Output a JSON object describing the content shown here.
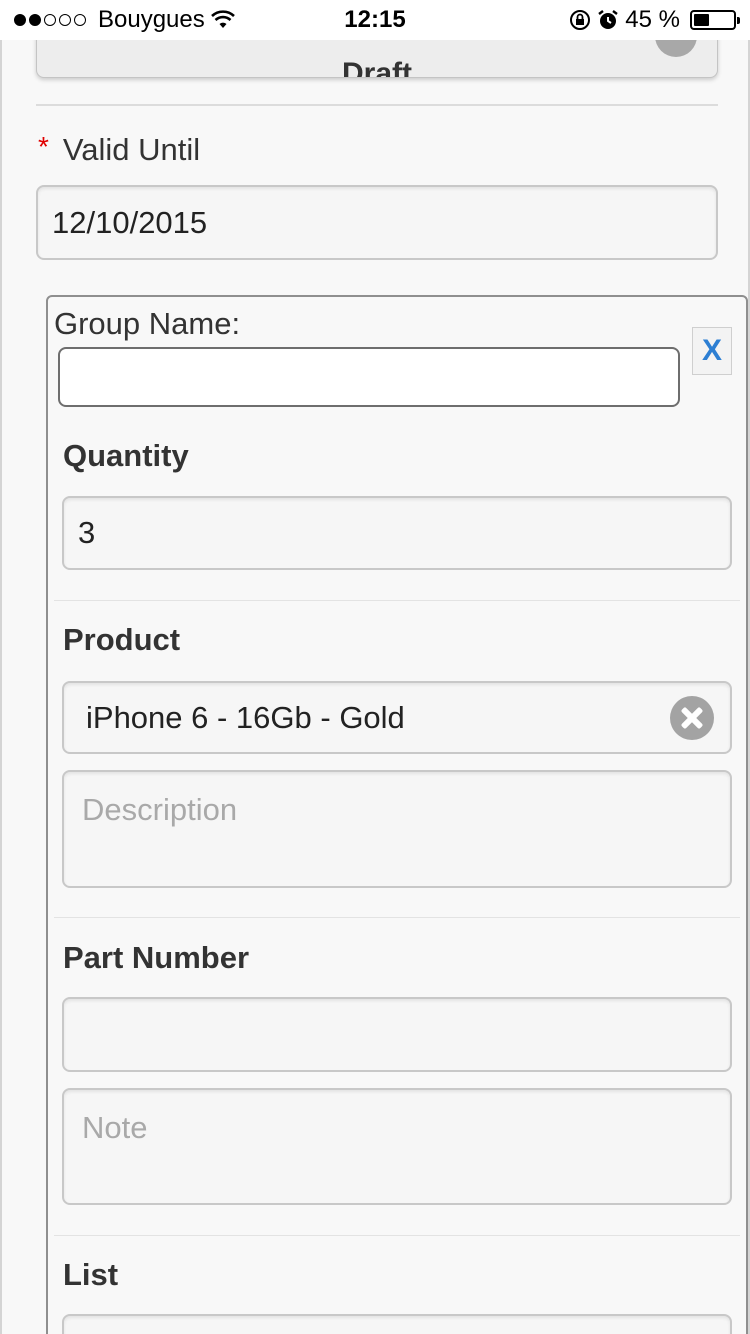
{
  "status_bar": {
    "carrier": "Bouygues",
    "time": "12:15",
    "battery_percent": "45 %",
    "battery_level": 0.45,
    "signal_bars_filled": 2,
    "signal_bars_total": 5
  },
  "status": {
    "selected": "Draft"
  },
  "valid_until": {
    "label": "Valid Until",
    "required_mark": "*",
    "value": "12/10/2015"
  },
  "group": {
    "name_label": "Group Name:",
    "name_value": "",
    "remove_label": "X",
    "quantity": {
      "label": "Quantity",
      "value": "3"
    },
    "product": {
      "label": "Product",
      "value": "iPhone 6 - 16Gb - Gold",
      "description_placeholder": "Description"
    },
    "part_number": {
      "label": "Part Number",
      "value": "",
      "note_placeholder": "Note"
    },
    "list": {
      "label": "List"
    }
  },
  "colors": {
    "required": "#e00000",
    "link": "#2d7fd3",
    "page_bg": "#f8f8f8"
  }
}
